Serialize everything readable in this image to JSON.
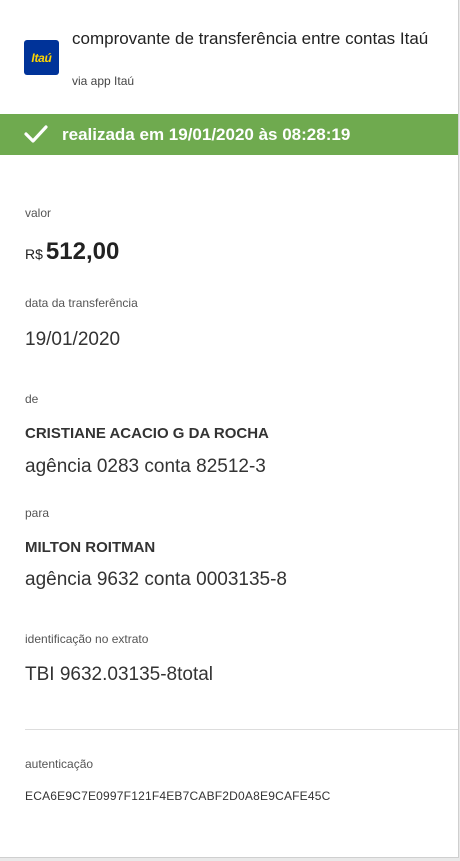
{
  "header": {
    "logo_text": "Itaú",
    "title": "comprovante de transferência entre contas Itaú",
    "subtitle": "via app Itaú",
    "logo_icon": "itau-logo-icon"
  },
  "status": {
    "text": "realizada em 19/01/2020 às 08:28:19",
    "icon": "check-icon",
    "color": "#6faa4f"
  },
  "valor": {
    "label": "valor",
    "currency": "R$",
    "amount": "512,00"
  },
  "data_transferencia": {
    "label": "data da transferência",
    "value": "19/01/2020"
  },
  "de": {
    "label": "de",
    "name": "CRISTIANE ACACIO G DA ROCHA",
    "account": "agência 0283 conta 82512-3"
  },
  "para": {
    "label": "para",
    "name": "MILTON ROITMAN",
    "account": "agência 9632 conta 0003135-8"
  },
  "identificacao": {
    "label": "identificação no extrato",
    "value": "TBI 9632.03135-8total"
  },
  "autenticacao": {
    "label": "autenticação",
    "code": "ECA6E9C7E0997F121F4EB7CABF2D0A8E9CAFE45C"
  }
}
